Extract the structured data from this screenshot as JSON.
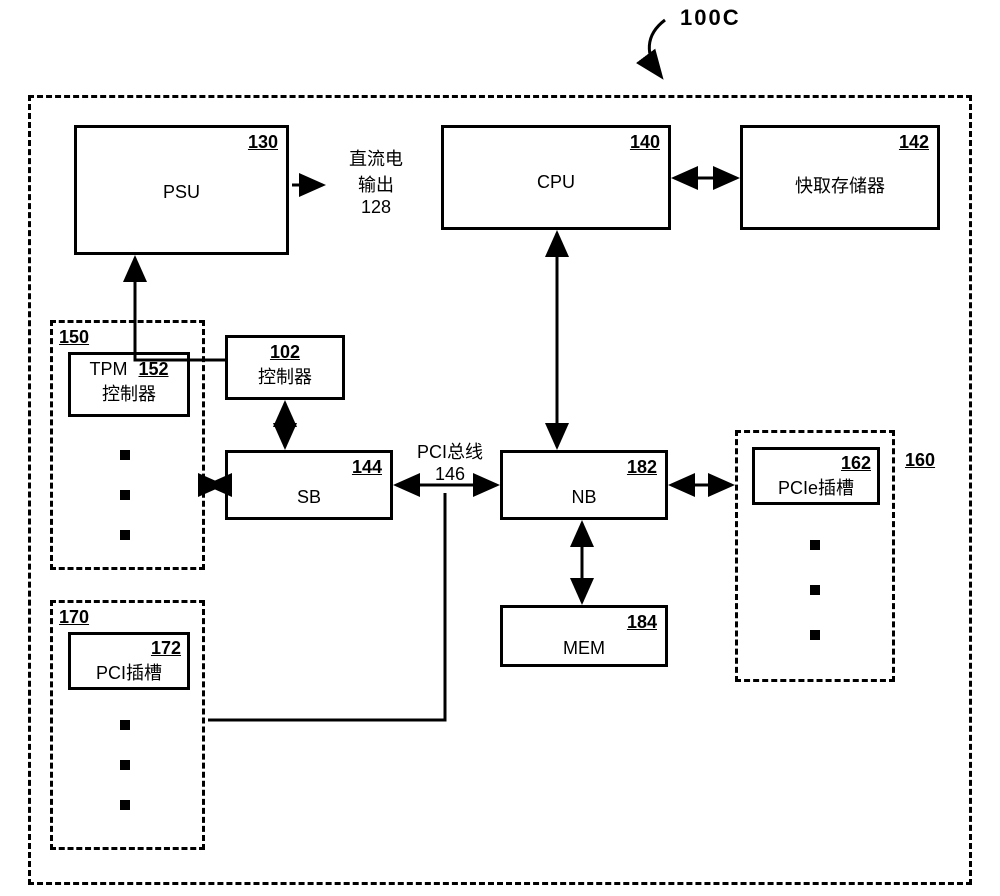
{
  "figure_ref": "100C",
  "blocks": {
    "psu": {
      "label": "PSU",
      "ref": "130"
    },
    "cpu": {
      "label": "CPU",
      "ref": "140"
    },
    "cache": {
      "label": "快取存储器",
      "ref": "142"
    },
    "ctrl": {
      "label": "控制器",
      "ref": "102"
    },
    "sb": {
      "label": "SB",
      "ref": "144"
    },
    "nb": {
      "label": "NB",
      "ref": "182"
    },
    "mem": {
      "label": "MEM",
      "ref": "184"
    },
    "tpm_group": {
      "ref": "150"
    },
    "tpm": {
      "label": "TPM",
      "sub": "控制器",
      "ref": "152"
    },
    "pci_group": {
      "ref": "170"
    },
    "pci": {
      "label": "PCI插槽",
      "ref": "172"
    },
    "pcie_group": {
      "ref": "160"
    },
    "pcie": {
      "label": "PCIe插槽",
      "ref": "162"
    },
    "dcout": {
      "line1": "直流电",
      "line2": "输出",
      "ref": "128"
    },
    "pcibus": {
      "label": "PCI总线",
      "ref": "146"
    }
  }
}
